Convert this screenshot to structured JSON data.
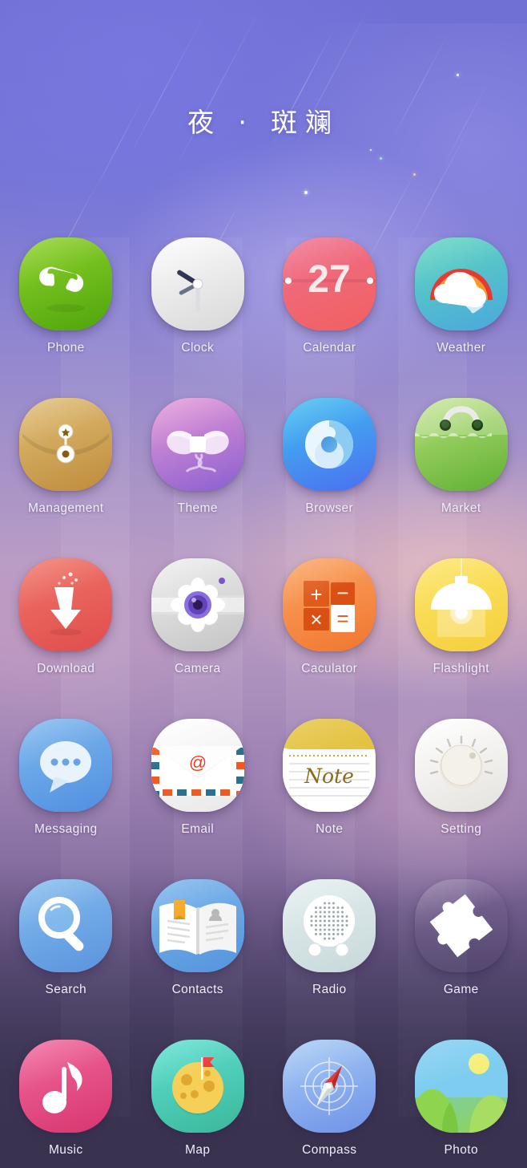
{
  "wallpaper": {
    "title": "夜 · 斑斓",
    "gradient_top": "#6f6fd4",
    "gradient_mid": "#b69bc4",
    "gradient_bottom": "#3a3350",
    "accent_warm": "#f7c4ba"
  },
  "grid": {
    "columns": 4,
    "rows": 6,
    "apps": [
      {
        "label": "Phone",
        "icon": "phone-handset-icon",
        "bg_from": "#8ed22a",
        "bg_to": "#4fa40c"
      },
      {
        "label": "Clock",
        "icon": "analog-clock-icon",
        "bg_from": "#fcfcfc",
        "bg_to": "#d8d8d8"
      },
      {
        "label": "Calendar",
        "icon": "calendar-date-icon",
        "bg_from": "#ef6f8e",
        "bg_to": "#f0605e",
        "value": "27"
      },
      {
        "label": "Weather",
        "icon": "rainbow-cloud-icon",
        "bg_from": "#5fd6bd",
        "bg_to": "#49a8dd"
      },
      {
        "label": "Management",
        "icon": "envelope-clasp-icon",
        "bg_from": "#e0bf77",
        "bg_to": "#bf8b3a"
      },
      {
        "label": "Theme",
        "icon": "ribbon-bow-icon",
        "bg_from": "#e79ad6",
        "bg_to": "#8a5fd0"
      },
      {
        "label": "Browser",
        "icon": "swirl-compass-icon",
        "bg_from": "#3fc0f0",
        "bg_to": "#4b6ef0"
      },
      {
        "label": "Market",
        "icon": "shopping-bag-icon",
        "bg_from": "#b8e07a",
        "bg_to": "#5fb032"
      },
      {
        "label": "Download",
        "icon": "down-arrow-icon",
        "bg_from": "#f0766a",
        "bg_to": "#e04c4c"
      },
      {
        "label": "Camera",
        "icon": "flower-lens-icon",
        "bg_from": "#efefef",
        "bg_to": "#c4c4c4"
      },
      {
        "label": "Caculator",
        "icon": "calculator-keys-icon",
        "bg_from": "#fba463",
        "bg_to": "#f0762e"
      },
      {
        "label": "Flashlight",
        "icon": "hanging-lamp-icon",
        "bg_from": "#fde56a",
        "bg_to": "#f5cf3c"
      },
      {
        "label": "Messaging",
        "icon": "speech-bubble-icon",
        "bg_from": "#7fb8ee",
        "bg_to": "#4f8fe0"
      },
      {
        "label": "Email",
        "icon": "airmail-envelope-icon",
        "bg_from": "#ffffff",
        "bg_to": "#e8e8e8"
      },
      {
        "label": "Note",
        "icon": "lined-notepad-icon",
        "bg_from": "#fbfbfb",
        "bg_to": "#ededed"
      },
      {
        "label": "Setting",
        "icon": "control-knob-icon",
        "bg_from": "#ffffff",
        "bg_to": "#e4e2de"
      },
      {
        "label": "Search",
        "icon": "magnifier-icon",
        "bg_from": "#85bdee",
        "bg_to": "#5a93dd"
      },
      {
        "label": "Contacts",
        "icon": "open-book-icon",
        "bg_from": "#7cb6ec",
        "bg_to": "#5494dd"
      },
      {
        "label": "Radio",
        "icon": "speaker-grille-icon",
        "bg_from": "#e5eff0",
        "bg_to": "#c7d8da"
      },
      {
        "label": "Game",
        "icon": "puzzle-piece-icon",
        "bg_from": "#fdc košt54",
        "bg_to": "#f5a623"
      },
      {
        "label": "Music",
        "icon": "music-note-icon",
        "bg_from": "#f06a9e",
        "bg_to": "#d8356e"
      },
      {
        "label": "Map",
        "icon": "island-flag-icon",
        "bg_from": "#5fe0d2",
        "bg_to": "#3bb79a"
      },
      {
        "label": "Compass",
        "icon": "compass-needle-icon",
        "bg_from": "#a8cdf5",
        "bg_to": "#6f91e8"
      },
      {
        "label": "Photo",
        "icon": "landscape-photo-icon",
        "bg_from": "#6ec8ee",
        "bg_to": "#8fd451"
      }
    ]
  }
}
